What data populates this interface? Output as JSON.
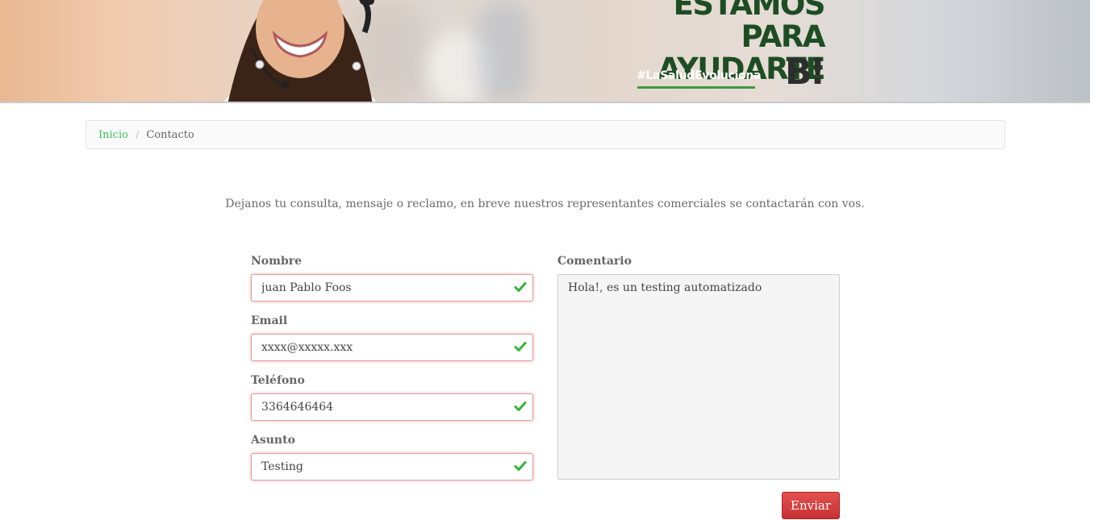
{
  "banner": {
    "headline_line1": "ESTAMOS PARA",
    "headline_line2": "AYUDARTE",
    "hashtag": "#LaSaludEvoluciona",
    "brand_logo": "B!",
    "colors": {
      "headline": "#1d4d23",
      "hashtag_underline": "#3c9b3e"
    }
  },
  "breadcrumb": {
    "home": "Inicio",
    "separator": "/",
    "current": "Contacto"
  },
  "intro": "Dejanos tu consulta, mensaje o reclamo, en breve nuestros representantes comerciales se contactarán con vos.",
  "form": {
    "nombre": {
      "label": "Nombre",
      "value": "juan Pablo Foos",
      "status": "valid"
    },
    "email": {
      "label": "Email",
      "value": "xxxx@xxxxx.xxx",
      "status": "valid"
    },
    "telefono": {
      "label": "Teléfono",
      "value": "3364646464",
      "status": "valid"
    },
    "asunto": {
      "label": "Asunto",
      "value": "Testing",
      "status": "valid"
    },
    "comentario": {
      "label": "Comentario",
      "value": "Hola!, es un testing automatizado"
    },
    "submit_label": "Enviar",
    "colors": {
      "valid_check": "#35b335",
      "field_border": "#e49a9a",
      "submit": "#d43b3b",
      "link": "#3cc35f"
    }
  }
}
